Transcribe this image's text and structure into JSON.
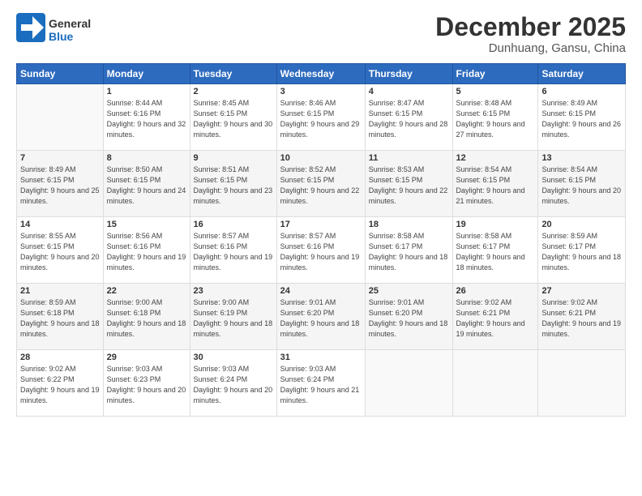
{
  "header": {
    "logo_line1": "General",
    "logo_line2": "Blue",
    "month": "December 2025",
    "location": "Dunhuang, Gansu, China"
  },
  "weekdays": [
    "Sunday",
    "Monday",
    "Tuesday",
    "Wednesday",
    "Thursday",
    "Friday",
    "Saturday"
  ],
  "weeks": [
    [
      {
        "day": "",
        "sunrise": "",
        "sunset": "",
        "daylight": ""
      },
      {
        "day": "1",
        "sunrise": "Sunrise: 8:44 AM",
        "sunset": "Sunset: 6:16 PM",
        "daylight": "Daylight: 9 hours and 32 minutes."
      },
      {
        "day": "2",
        "sunrise": "Sunrise: 8:45 AM",
        "sunset": "Sunset: 6:15 PM",
        "daylight": "Daylight: 9 hours and 30 minutes."
      },
      {
        "day": "3",
        "sunrise": "Sunrise: 8:46 AM",
        "sunset": "Sunset: 6:15 PM",
        "daylight": "Daylight: 9 hours and 29 minutes."
      },
      {
        "day": "4",
        "sunrise": "Sunrise: 8:47 AM",
        "sunset": "Sunset: 6:15 PM",
        "daylight": "Daylight: 9 hours and 28 minutes."
      },
      {
        "day": "5",
        "sunrise": "Sunrise: 8:48 AM",
        "sunset": "Sunset: 6:15 PM",
        "daylight": "Daylight: 9 hours and 27 minutes."
      },
      {
        "day": "6",
        "sunrise": "Sunrise: 8:49 AM",
        "sunset": "Sunset: 6:15 PM",
        "daylight": "Daylight: 9 hours and 26 minutes."
      }
    ],
    [
      {
        "day": "7",
        "sunrise": "Sunrise: 8:49 AM",
        "sunset": "Sunset: 6:15 PM",
        "daylight": "Daylight: 9 hours and 25 minutes."
      },
      {
        "day": "8",
        "sunrise": "Sunrise: 8:50 AM",
        "sunset": "Sunset: 6:15 PM",
        "daylight": "Daylight: 9 hours and 24 minutes."
      },
      {
        "day": "9",
        "sunrise": "Sunrise: 8:51 AM",
        "sunset": "Sunset: 6:15 PM",
        "daylight": "Daylight: 9 hours and 23 minutes."
      },
      {
        "day": "10",
        "sunrise": "Sunrise: 8:52 AM",
        "sunset": "Sunset: 6:15 PM",
        "daylight": "Daylight: 9 hours and 22 minutes."
      },
      {
        "day": "11",
        "sunrise": "Sunrise: 8:53 AM",
        "sunset": "Sunset: 6:15 PM",
        "daylight": "Daylight: 9 hours and 22 minutes."
      },
      {
        "day": "12",
        "sunrise": "Sunrise: 8:54 AM",
        "sunset": "Sunset: 6:15 PM",
        "daylight": "Daylight: 9 hours and 21 minutes."
      },
      {
        "day": "13",
        "sunrise": "Sunrise: 8:54 AM",
        "sunset": "Sunset: 6:15 PM",
        "daylight": "Daylight: 9 hours and 20 minutes."
      }
    ],
    [
      {
        "day": "14",
        "sunrise": "Sunrise: 8:55 AM",
        "sunset": "Sunset: 6:15 PM",
        "daylight": "Daylight: 9 hours and 20 minutes."
      },
      {
        "day": "15",
        "sunrise": "Sunrise: 8:56 AM",
        "sunset": "Sunset: 6:16 PM",
        "daylight": "Daylight: 9 hours and 19 minutes."
      },
      {
        "day": "16",
        "sunrise": "Sunrise: 8:57 AM",
        "sunset": "Sunset: 6:16 PM",
        "daylight": "Daylight: 9 hours and 19 minutes."
      },
      {
        "day": "17",
        "sunrise": "Sunrise: 8:57 AM",
        "sunset": "Sunset: 6:16 PM",
        "daylight": "Daylight: 9 hours and 19 minutes."
      },
      {
        "day": "18",
        "sunrise": "Sunrise: 8:58 AM",
        "sunset": "Sunset: 6:17 PM",
        "daylight": "Daylight: 9 hours and 18 minutes."
      },
      {
        "day": "19",
        "sunrise": "Sunrise: 8:58 AM",
        "sunset": "Sunset: 6:17 PM",
        "daylight": "Daylight: 9 hours and 18 minutes."
      },
      {
        "day": "20",
        "sunrise": "Sunrise: 8:59 AM",
        "sunset": "Sunset: 6:17 PM",
        "daylight": "Daylight: 9 hours and 18 minutes."
      }
    ],
    [
      {
        "day": "21",
        "sunrise": "Sunrise: 8:59 AM",
        "sunset": "Sunset: 6:18 PM",
        "daylight": "Daylight: 9 hours and 18 minutes."
      },
      {
        "day": "22",
        "sunrise": "Sunrise: 9:00 AM",
        "sunset": "Sunset: 6:18 PM",
        "daylight": "Daylight: 9 hours and 18 minutes."
      },
      {
        "day": "23",
        "sunrise": "Sunrise: 9:00 AM",
        "sunset": "Sunset: 6:19 PM",
        "daylight": "Daylight: 9 hours and 18 minutes."
      },
      {
        "day": "24",
        "sunrise": "Sunrise: 9:01 AM",
        "sunset": "Sunset: 6:20 PM",
        "daylight": "Daylight: 9 hours and 18 minutes."
      },
      {
        "day": "25",
        "sunrise": "Sunrise: 9:01 AM",
        "sunset": "Sunset: 6:20 PM",
        "daylight": "Daylight: 9 hours and 18 minutes."
      },
      {
        "day": "26",
        "sunrise": "Sunrise: 9:02 AM",
        "sunset": "Sunset: 6:21 PM",
        "daylight": "Daylight: 9 hours and 19 minutes."
      },
      {
        "day": "27",
        "sunrise": "Sunrise: 9:02 AM",
        "sunset": "Sunset: 6:21 PM",
        "daylight": "Daylight: 9 hours and 19 minutes."
      }
    ],
    [
      {
        "day": "28",
        "sunrise": "Sunrise: 9:02 AM",
        "sunset": "Sunset: 6:22 PM",
        "daylight": "Daylight: 9 hours and 19 minutes."
      },
      {
        "day": "29",
        "sunrise": "Sunrise: 9:03 AM",
        "sunset": "Sunset: 6:23 PM",
        "daylight": "Daylight: 9 hours and 20 minutes."
      },
      {
        "day": "30",
        "sunrise": "Sunrise: 9:03 AM",
        "sunset": "Sunset: 6:24 PM",
        "daylight": "Daylight: 9 hours and 20 minutes."
      },
      {
        "day": "31",
        "sunrise": "Sunrise: 9:03 AM",
        "sunset": "Sunset: 6:24 PM",
        "daylight": "Daylight: 9 hours and 21 minutes."
      },
      {
        "day": "",
        "sunrise": "",
        "sunset": "",
        "daylight": ""
      },
      {
        "day": "",
        "sunrise": "",
        "sunset": "",
        "daylight": ""
      },
      {
        "day": "",
        "sunrise": "",
        "sunset": "",
        "daylight": ""
      }
    ]
  ]
}
